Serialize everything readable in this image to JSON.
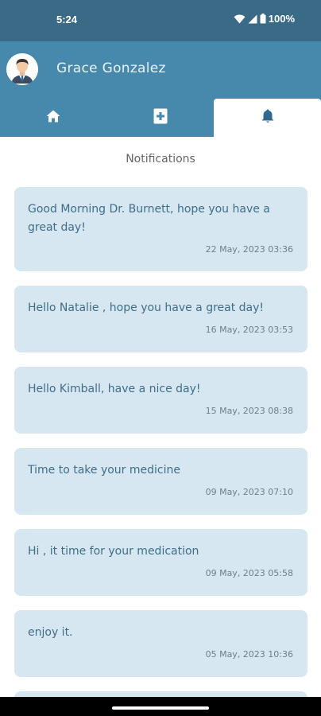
{
  "status_bar": {
    "time": "5:24",
    "battery": "100%",
    "icons": [
      "wifi-icon",
      "signal-icon",
      "battery-icon"
    ]
  },
  "header": {
    "user_name": "Grace Gonzalez",
    "avatar": "avatar-icon"
  },
  "tabs": [
    {
      "name": "home",
      "icon": "home-icon",
      "active": false
    },
    {
      "name": "medical",
      "icon": "medical-kit-icon",
      "active": false
    },
    {
      "name": "notifications",
      "icon": "bell-icon",
      "active": true
    }
  ],
  "section_title": "Notifications",
  "notifications": [
    {
      "message": "Good Morning Dr. Burnett, hope you have a great day!",
      "date": "22 May, 2023 03:36"
    },
    {
      "message": "Hello Natalie , hope you have a great day!",
      "date": "16 May, 2023 03:53"
    },
    {
      "message": "Hello Kimball, have a nice day!",
      "date": "15 May, 2023 08:38"
    },
    {
      "message": "Time to take your medicine",
      "date": "09 May, 2023 07:10"
    },
    {
      "message": "Hi , it time for your medication",
      "date": "09 May, 2023 05:58"
    },
    {
      "message": "enjoy it.",
      "date": "05 May, 2023 10:36"
    }
  ],
  "colors": {
    "status_bar": "#3a6a86",
    "header": "#4789ad",
    "card": "#d6e7f1",
    "message_text": "#3e6e8a"
  }
}
